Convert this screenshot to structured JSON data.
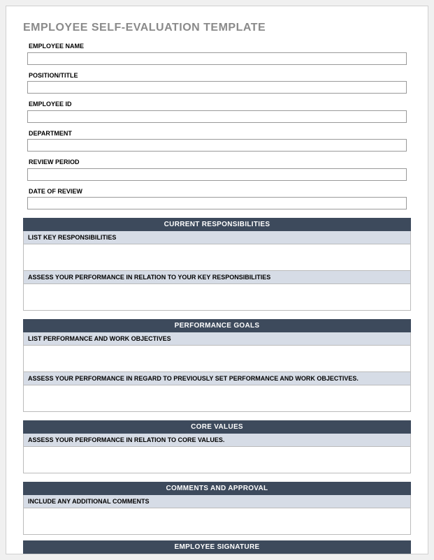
{
  "title": "EMPLOYEE SELF-EVALUATION TEMPLATE",
  "fields": {
    "employee_name": {
      "label": "EMPLOYEE NAME",
      "value": ""
    },
    "position_title": {
      "label": "POSITION/TITLE",
      "value": ""
    },
    "employee_id": {
      "label": "EMPLOYEE ID",
      "value": ""
    },
    "department": {
      "label": "DEPARTMENT",
      "value": ""
    },
    "review_period": {
      "label": "REVIEW PERIOD",
      "value": ""
    },
    "date_of_review": {
      "label": "DATE OF REVIEW",
      "value": ""
    }
  },
  "sections": {
    "current_responsibilities": {
      "header": "CURRENT RESPONSIBILITIES",
      "sub1": "LIST KEY RESPONSIBILITIES",
      "sub2": "ASSESS YOUR PERFORMANCE IN RELATION TO YOUR KEY RESPONSIBILITIES"
    },
    "performance_goals": {
      "header": "PERFORMANCE GOALS",
      "sub1": "LIST PERFORMANCE AND WORK OBJECTIVES",
      "sub2": "ASSESS YOUR PERFORMANCE IN REGARD TO PREVIOUSLY SET PERFORMANCE AND WORK OBJECTIVES."
    },
    "core_values": {
      "header": "CORE VALUES",
      "sub1": "ASSESS YOUR PERFORMANCE IN RELATION TO CORE VALUES."
    },
    "comments_approval": {
      "header": "COMMENTS AND APPROVAL",
      "sub1": "INCLUDE ANY ADDITIONAL COMMENTS"
    },
    "employee_signature": {
      "header": "EMPLOYEE SIGNATURE"
    }
  }
}
